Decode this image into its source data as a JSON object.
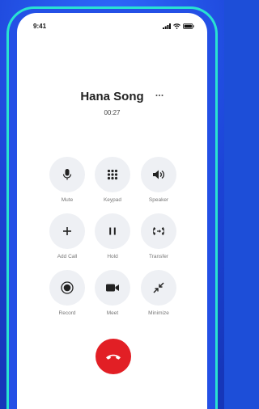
{
  "status_bar": {
    "time": "9:41"
  },
  "call": {
    "contact_name": "Hana Song",
    "duration": "00:27"
  },
  "controls": [
    {
      "label": "Mute",
      "icon": "microphone-icon"
    },
    {
      "label": "Keypad",
      "icon": "keypad-icon"
    },
    {
      "label": "Speaker",
      "icon": "speaker-icon"
    },
    {
      "label": "Add Call",
      "icon": "plus-icon"
    },
    {
      "label": "Hold",
      "icon": "pause-icon"
    },
    {
      "label": "Transfer",
      "icon": "transfer-icon"
    },
    {
      "label": "Record",
      "icon": "record-icon"
    },
    {
      "label": "Meet",
      "icon": "video-camera-icon"
    },
    {
      "label": "Minimize",
      "icon": "minimize-icon"
    }
  ],
  "colors": {
    "background": "#1d4ed8",
    "frame_accent": "#29e2d1",
    "end_call": "#e21f25",
    "control_bg": "#eef0f4"
  }
}
